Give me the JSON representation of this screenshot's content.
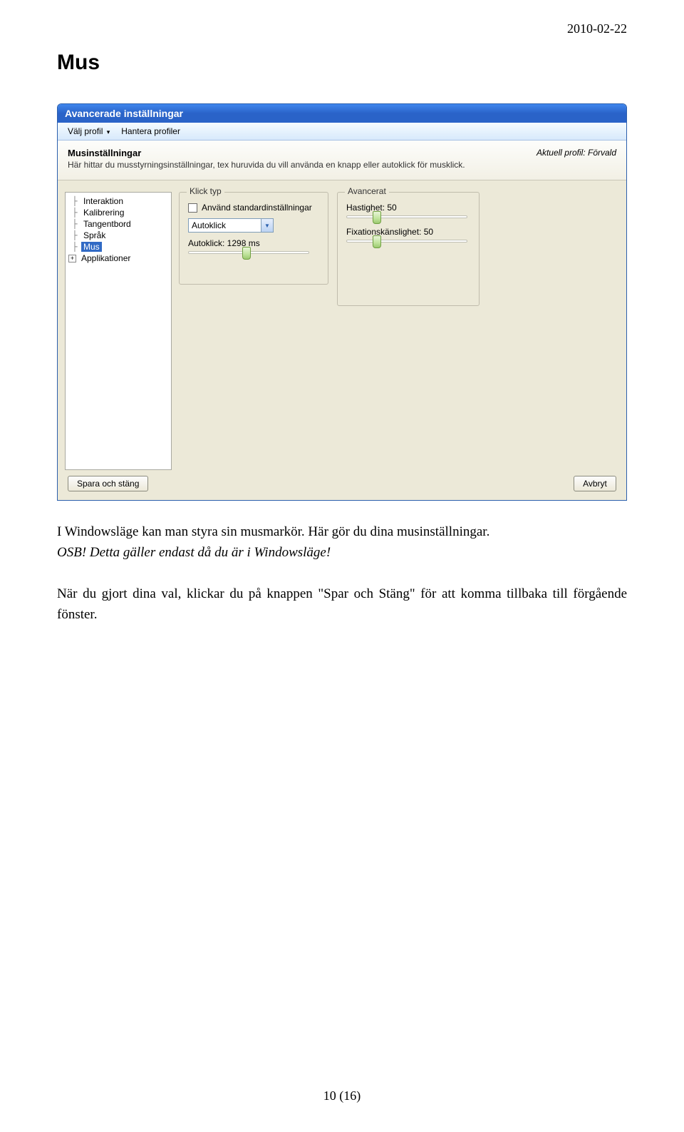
{
  "page": {
    "date": "2010-02-22",
    "section_title": "Mus",
    "para1a": "I Windowsläge kan man styra sin musmarkör.   Här gör du dina musinställningar.",
    "para1b": "OSB! Detta gäller endast då du är i Windowsläge!",
    "para2": "När du gjort dina val, klickar du på knappen \"Spar och Stäng\" för att komma tillbaka till förgående fönster.",
    "page_number": "10 (16)"
  },
  "window": {
    "title": "Avancerade inställningar",
    "menu": {
      "item1": "Välj profil",
      "item2": "Hantera profiler"
    },
    "header": {
      "title": "Musinställningar",
      "subtitle": "Här hittar du musstyrningsinställningar, tex huruvida du vill använda en knapp eller autoklick för musklick.",
      "profile": "Aktuell profil: Förvald"
    },
    "tree": {
      "items": [
        "Interaktion",
        "Kalibrering",
        "Tangentbord",
        "Språk",
        "Mus",
        "Applikationer"
      ]
    },
    "click_group": {
      "legend": "Klick typ",
      "use_default": "Använd standardinställningar",
      "combo_value": "Autoklick",
      "autoklick_label": "Autoklick: 1298 ms"
    },
    "adv_group": {
      "legend": "Avancerat",
      "speed_label": "Hastighet: 50",
      "fix_label": "Fixationskänslighet: 50"
    },
    "buttons": {
      "save": "Spara och stäng",
      "cancel": "Avbryt"
    }
  }
}
